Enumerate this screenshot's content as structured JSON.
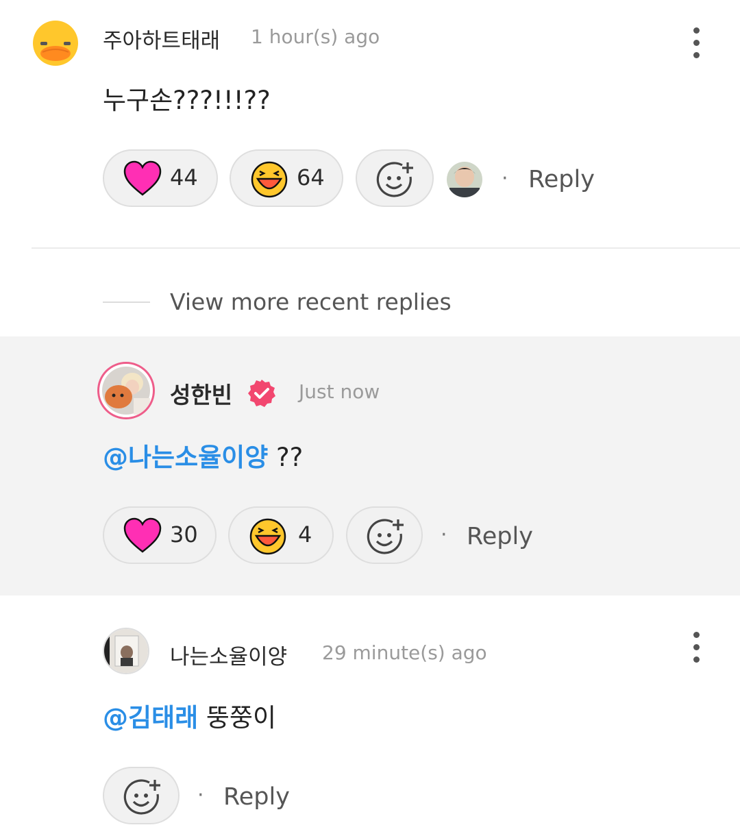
{
  "comment1": {
    "author": "주아하트태래",
    "time": "1 hour(s) ago",
    "text": "누구손???!!!??",
    "reactions": [
      {
        "icon": "heart-icon",
        "count": "44"
      },
      {
        "icon": "laughing-face-icon",
        "count": "64"
      }
    ],
    "reply_label": "Reply",
    "dot": "·"
  },
  "view_more_label": "View more recent replies",
  "reply1": {
    "author": "성한빈",
    "time": "Just now",
    "mention": "@나는소율이양",
    "text": " ??",
    "reactions": [
      {
        "icon": "heart-icon",
        "count": "30"
      },
      {
        "icon": "laughing-face-icon",
        "count": "4"
      }
    ],
    "reply_label": "Reply",
    "dot": "·"
  },
  "reply2": {
    "author": "나는소율이양",
    "time": "29 minute(s) ago",
    "mention": "@김태래",
    "text": " 뚱쭝이",
    "reply_label": "Reply",
    "dot": "·"
  },
  "colors": {
    "heart": "#ff2fb4",
    "mention": "#2a8ee6",
    "verified": "#f2476f",
    "highlight_bg": "#f3f3f3"
  }
}
